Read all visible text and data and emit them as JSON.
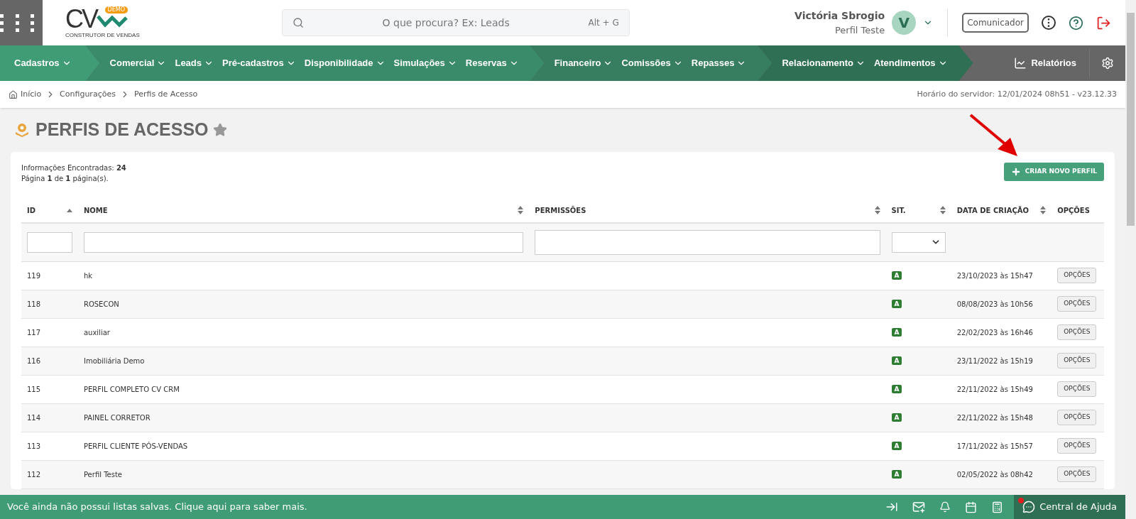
{
  "logo": {
    "letters": "CV",
    "badge": "DEMO",
    "tagline": "CONSTRUTOR DE VENDAS"
  },
  "search": {
    "placeholder": "O que procura? Ex: Leads",
    "shortcut": "Alt + G"
  },
  "user": {
    "name": "Victória Sbrogio",
    "profile": "Perfil Teste",
    "initial": "V"
  },
  "communicator_button": "Comunicador",
  "nav": [
    {
      "items": [
        "Cadastros"
      ]
    },
    {
      "items": [
        "Comercial",
        "Leads",
        "Pré-cadastros",
        "Disponibilidade",
        "Simulações",
        "Reservas"
      ]
    },
    {
      "items": [
        "Financeiro",
        "Comissões",
        "Repasses"
      ]
    },
    {
      "items": [
        "Relacionamento",
        "Atendimentos"
      ]
    }
  ],
  "reports_link": "Relatórios",
  "breadcrumb": [
    "Início",
    "Configurações",
    "Perfis de Acesso"
  ],
  "server_time": "Horário do servidor: 12/01/2024 08h51 - v23.12.33",
  "page_title": "PERFIS DE ACESSO",
  "summary": {
    "found": "Informações Encontradas: **24**",
    "page": "Página **1** de **1** página(s)."
  },
  "create_button": "CRIAR NOVO PERFIL",
  "table": {
    "columns": [
      {
        "label": "ID",
        "kind": "ascending"
      },
      {
        "label": "NOME",
        "kind": "sortable"
      },
      {
        "label": "PERMISSÕES",
        "kind": "sortable"
      },
      {
        "label": "SIT.",
        "kind": "sortable"
      },
      {
        "label": "DATA DE CRIAÇÃO",
        "kind": "sortable"
      },
      {
        "label": "OPÇÕES",
        "kind": "plain"
      }
    ],
    "filters": [
      {
        "kind": "input"
      },
      {
        "kind": "input"
      },
      {
        "kind": "wide-input"
      },
      {
        "kind": "select"
      },
      {
        "kind": "blank"
      },
      {
        "kind": "blank"
      }
    ],
    "rows": [
      {
        "id": "119",
        "name": "hk",
        "status": "A",
        "created": "23/10/2023 às 15h47",
        "options": "OPÇÕES"
      },
      {
        "id": "118",
        "name": "ROSECON",
        "status": "A",
        "created": "08/08/2023 às 10h56",
        "options": "OPÇÕES"
      },
      {
        "id": "117",
        "name": "auxiliar",
        "status": "A",
        "created": "22/02/2023 às 16h46",
        "options": "OPÇÕES"
      },
      {
        "id": "116",
        "name": "Imobiliária Demo",
        "status": "A",
        "created": "23/11/2022 às 15h19",
        "options": "OPÇÕES"
      },
      {
        "id": "115",
        "name": "PERFIL COMPLETO CV CRM",
        "status": "A",
        "created": "22/11/2022 às 15h49",
        "options": "OPÇÕES"
      },
      {
        "id": "114",
        "name": "PAINEL CORRETOR",
        "status": "A",
        "created": "22/11/2022 às 15h48",
        "options": "OPÇÕES"
      },
      {
        "id": "113",
        "name": "PERFIL CLIENTE PÓS-VENDAS",
        "status": "A",
        "created": "17/11/2022 às 15h57",
        "options": "OPÇÕES"
      },
      {
        "id": "112",
        "name": "Perfil Teste",
        "status": "A",
        "created": "02/05/2022 às 08h42",
        "options": "OPÇÕES"
      }
    ]
  },
  "footer": {
    "message": "Você ainda não possui listas salvas. Clique aqui para saber mais.",
    "help_button": "Central de Ajuda"
  }
}
